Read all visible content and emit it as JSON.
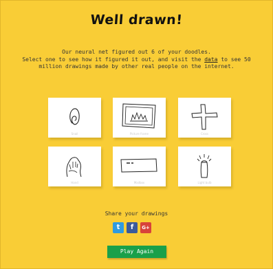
{
  "header": {
    "title": "Well drawn!"
  },
  "intro": {
    "line1": "Our neural net figured out 6 of your doodles.",
    "line2_before": "Select one to see how it figured it out, and visit the ",
    "data_link": "data",
    "line2_after": " to see 50 million drawings made by other real people on the internet."
  },
  "drawings": [
    {
      "label": "Snail",
      "icon": "spiral-doodle"
    },
    {
      "label": "Picture frame",
      "icon": "framed-picture-doodle"
    },
    {
      "label": "Cross",
      "icon": "cross-doodle"
    },
    {
      "label": "Hand",
      "icon": "hand-doodle"
    },
    {
      "label": "Mailbox",
      "icon": "rectangle-doodle"
    },
    {
      "label": "Light bulb",
      "icon": "light-bulb-doodle"
    }
  ],
  "share": {
    "label": "Share your drawings",
    "twitter": "t",
    "facebook": "f",
    "google_plus": "G+"
  },
  "actions": {
    "play_again": "Play Again"
  },
  "colors": {
    "background": "#F9CD36",
    "play_button": "#19A04A"
  }
}
